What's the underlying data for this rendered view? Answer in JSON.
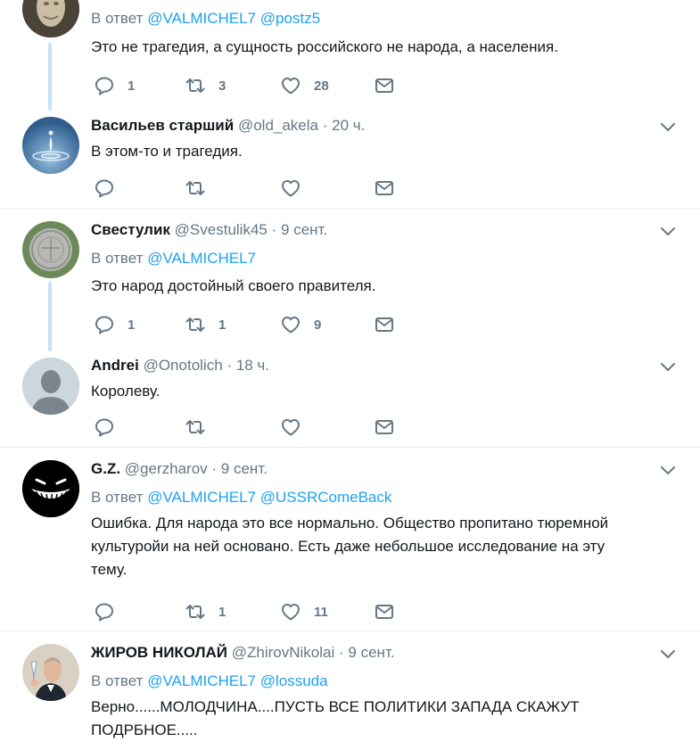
{
  "reply_prefix": "В ответ",
  "tweets": [
    {
      "name": "",
      "handle": "",
      "dot": "",
      "time": "",
      "reply_to": [
        "@VALMICHEL7",
        "@postz5"
      ],
      "text": "Это не трагедия, а сущность российского не народа, а населения.",
      "replies": "1",
      "retweets": "3",
      "likes": "28",
      "avatar_icon": "statue-icon"
    },
    {
      "name": "Васильев старший",
      "handle": "@old_akela",
      "dot": "·",
      "time": "20 ч.",
      "reply_to": [],
      "text": "В этом-то и трагедия.",
      "replies": "",
      "retweets": "",
      "likes": "",
      "avatar_icon": "water-drop-icon"
    },
    {
      "name": "Свестулик",
      "handle": "@Svestulik45",
      "dot": "·",
      "time": "9 сент.",
      "reply_to": [
        "@VALMICHEL7"
      ],
      "text": "Это народ достойный своего правителя.",
      "replies": "1",
      "retweets": "1",
      "likes": "9",
      "avatar_icon": "coin-icon"
    },
    {
      "name": "Andrei",
      "handle": "@Onotolich",
      "dot": "·",
      "time": "18 ч.",
      "reply_to": [],
      "text": "Королеву.",
      "replies": "",
      "retweets": "",
      "likes": "",
      "avatar_icon": "default-user-icon"
    },
    {
      "name": "G.Z.",
      "handle": "@gerzharov",
      "dot": "·",
      "time": "9 сент.",
      "reply_to": [
        "@VALMICHEL7",
        "@USSRComeBack"
      ],
      "text": "Ошибка. Для народа это все нормально. Общество пропитано тюремной\nкультуройи на ней основано. Есть даже небольшое исследование на эту\nтему.",
      "replies": "",
      "retweets": "1",
      "likes": "11",
      "avatar_icon": "grin-face-icon"
    },
    {
      "name": "ЖИРОВ НИКОЛАЙ",
      "handle": "@ZhirovNikolai",
      "dot": "·",
      "time": "9 сент.",
      "reply_to": [
        "@VALMICHEL7",
        "@lossuda"
      ],
      "text": "Верно......МОЛОДЧИНА....ПУСТЬ ВСЕ ПОЛИТИКИ ЗАПАДА СКАЖУТ\nПОДРБНОЕ.....",
      "replies": "",
      "retweets": "",
      "likes": "",
      "avatar_icon": "man-with-glass-icon"
    }
  ]
}
